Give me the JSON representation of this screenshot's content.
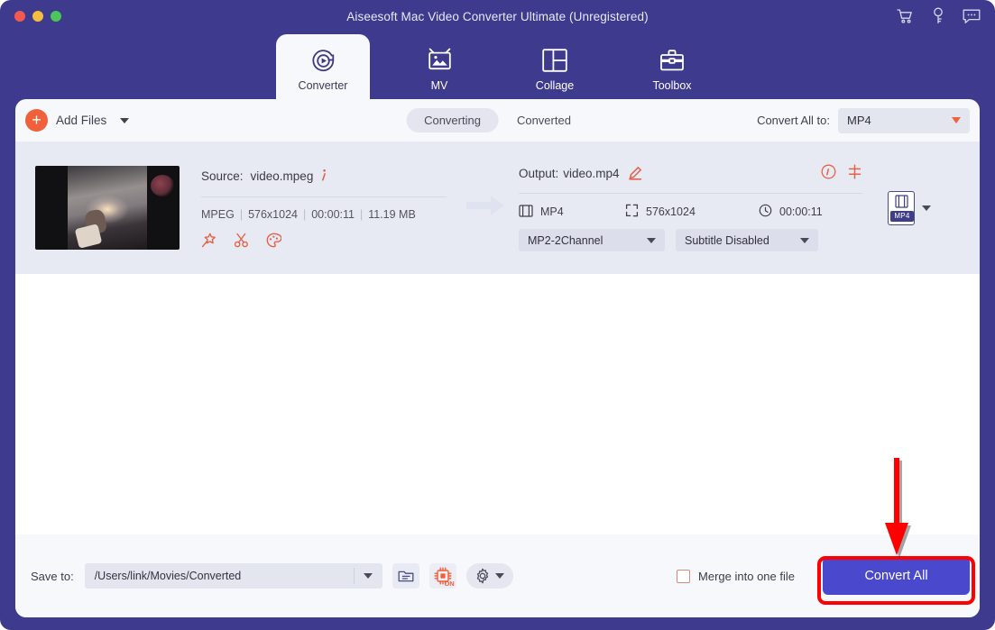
{
  "window": {
    "title": "Aiseesoft Mac Video Converter Ultimate (Unregistered)",
    "traffic_lights": [
      "close",
      "minimize",
      "maximize"
    ],
    "icons": [
      {
        "name": "cart-icon",
        "glyph": "cart"
      },
      {
        "name": "key-icon",
        "glyph": "key"
      },
      {
        "name": "message-icon",
        "glyph": "message"
      }
    ]
  },
  "tabs": [
    {
      "label": "Converter",
      "icon": "converter-icon",
      "active": true
    },
    {
      "label": "MV",
      "icon": "mv-icon",
      "active": false
    },
    {
      "label": "Collage",
      "icon": "collage-icon",
      "active": false
    },
    {
      "label": "Toolbox",
      "icon": "toolbox-icon",
      "active": false
    }
  ],
  "toolbar": {
    "add_files_label": "Add Files",
    "segments": [
      {
        "label": "Converting",
        "active": true
      },
      {
        "label": "Converted",
        "active": false
      }
    ],
    "convert_all_to_label": "Convert All to:",
    "format_value": "MP4"
  },
  "file": {
    "source_label": "Source:",
    "source_name": "video.mpeg",
    "meta": {
      "codec": "MPEG",
      "resolution": "576x1024",
      "duration": "00:00:11",
      "size": "11.19 MB"
    },
    "edit_icons": [
      {
        "name": "effects-icon"
      },
      {
        "name": "trim-scissors-icon"
      },
      {
        "name": "palette-icon"
      }
    ],
    "output_label": "Output:",
    "output_name": "video.mp4",
    "output_specs": {
      "format": "MP4",
      "resolution": "576x1024",
      "duration": "00:00:11"
    },
    "audio_track": "MP2-2Channel",
    "subtitle_track": "Subtitle Disabled",
    "format_badge": "MP4"
  },
  "bottom": {
    "save_to_label": "Save to:",
    "save_path": "/Users/link/Movies/Converted",
    "gpu_badge": "ON",
    "merge_label": "Merge into one file",
    "merge_checked": false,
    "convert_all_label": "Convert All"
  },
  "colors": {
    "header_purple": "#3e3a8e",
    "panel_bg": "#f7f8fc",
    "card_bg": "#e8eaf3",
    "accent_orange": "#f0603a",
    "primary_button": "#4a48cd",
    "annotation_red": "#ff0000"
  }
}
